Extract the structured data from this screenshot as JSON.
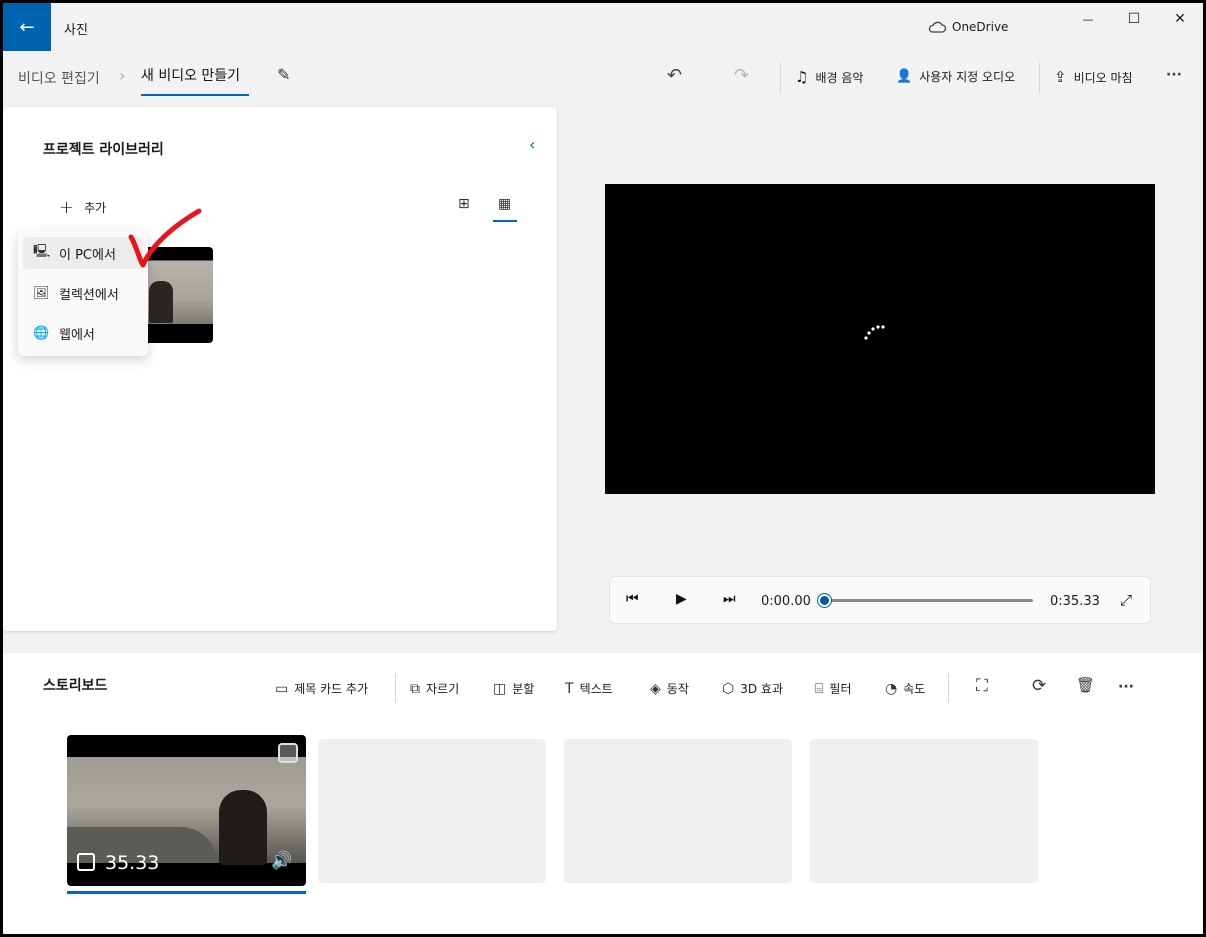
{
  "titlebar": {
    "back_glyph": "←",
    "app_title": "사진",
    "onedrive_label": "OneDrive",
    "onedrive_icon": "cloud-icon",
    "minimize_glyph": "—",
    "maximize_glyph": "☐",
    "close_glyph": "✕"
  },
  "commandbar": {
    "breadcrumb_parent": "비디오 편집기",
    "breadcrumb_sep": "›",
    "breadcrumb_current": "새 비디오 만들기",
    "rename_glyph": "✎",
    "undo_glyph": "↶",
    "redo_glyph": "↷",
    "music_glyph": "♫",
    "music_label": "배경 음악",
    "audio_glyph": "👤",
    "audio_label": "사용자 지정 오디오",
    "finish_glyph": "⇪",
    "finish_label": "비디오 마침",
    "more_glyph": "···"
  },
  "library": {
    "title": "프로젝트 라이브러리",
    "collapse_glyph": "‹",
    "add_glyph": "+",
    "add_label": "추가",
    "view_large_glyph": "⊞",
    "view_small_glyph": "▦",
    "menu": [
      {
        "icon": "pc-icon",
        "glyph": "🖳",
        "label": "이 PC에서"
      },
      {
        "icon": "collection-icon",
        "glyph": "🖼",
        "label": "컬렉션에서"
      },
      {
        "icon": "web-icon",
        "glyph": "🌐",
        "label": "웹에서"
      }
    ]
  },
  "player": {
    "prev_glyph": "⏮",
    "play_glyph": "▶",
    "next_glyph": "⏭",
    "current_time": "0:00.00",
    "total_time": "0:35.33",
    "progress": 0.0,
    "expand_glyph": "⤢"
  },
  "storyboard": {
    "title": "스토리보드",
    "tools": [
      {
        "icon": "title-card-icon",
        "glyph": "▭",
        "label": "제목 카드 추가"
      },
      {
        "icon": "trim-icon",
        "glyph": "⧉",
        "label": "자르기"
      },
      {
        "icon": "split-icon",
        "glyph": "◫",
        "label": "분할"
      },
      {
        "icon": "text-icon",
        "glyph": "T",
        "label": "텍스트"
      },
      {
        "icon": "motion-icon",
        "glyph": "◈",
        "label": "동작"
      },
      {
        "icon": "3d-effects-icon",
        "glyph": "⬡",
        "label": "3D 효과"
      },
      {
        "icon": "filter-icon",
        "glyph": "⌸",
        "label": "필터"
      },
      {
        "icon": "speed-icon",
        "glyph": "◔",
        "label": "속도"
      }
    ],
    "resize_glyph": "⛶",
    "rotate_glyph": "⟳",
    "delete_glyph": "🗑",
    "more_glyph": "···",
    "clip": {
      "duration": "35.33",
      "volume_glyph": "🔊"
    }
  },
  "colors": {
    "accent": "#0067c0",
    "back_button": "#0063b1",
    "annotation": "#e8161c"
  }
}
